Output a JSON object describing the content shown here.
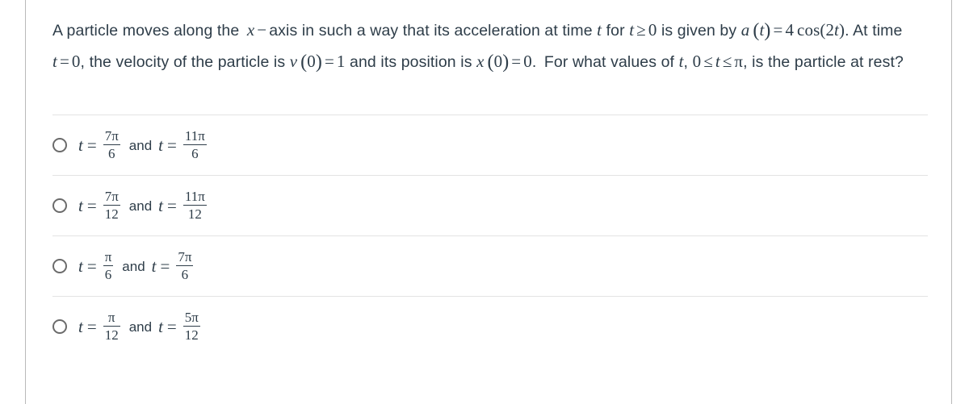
{
  "question": {
    "line1_part1": "A particle moves along the",
    "var_x": "x",
    "dash": "−",
    "line1_part2": "axis in such a way that its acceleration at time",
    "var_t_1": "t",
    "line1_part3": "for",
    "var_t_2": "t",
    "ge": "≥",
    "zero_1": "0",
    "line1_part4": "is",
    "line2_part1": "given by",
    "accel_a": "a",
    "accel_open": "(",
    "accel_t": "t",
    "accel_close": ")",
    "eq_1": "=",
    "coef_4": "4",
    "cos_text": "cos",
    "cos_open": "(",
    "cos_2": "2",
    "cos_t": "t",
    "cos_close": ")",
    "period_1": ".",
    "line2_part2": "At time",
    "var_t_3": "t",
    "eq_2": "=",
    "zero_2": "0",
    "comma_1": ",",
    "line2_part3": "the velocity of the particle is",
    "vel_v": "v",
    "vel_open": "(",
    "vel_zero": "0",
    "vel_close": ")",
    "eq_3": "=",
    "one": "1",
    "line2_part4": "and its",
    "line3_part1": "position is",
    "pos_x": "x",
    "pos_open": "(",
    "pos_zero": "0",
    "pos_close": ")",
    "eq_4": "=",
    "zero_3": "0",
    "period_2": ".",
    "line3_part2": "For what values of",
    "var_t_4": "t",
    "comma_2": ",",
    "zero_4": "0",
    "le_1": "≤",
    "var_t_5": "t",
    "le_2": "≤",
    "pi_sym": "π",
    "comma_3": ",",
    "line3_part3": "is the particle at rest?"
  },
  "options": [
    {
      "id": "option-a",
      "lhs_var": "t",
      "lhs_eq": "=",
      "frac1_num": "7π",
      "frac1_den": "6",
      "connector": "and",
      "rhs_var": "t",
      "rhs_eq": "=",
      "frac2_num": "11π",
      "frac2_den": "6",
      "selected": false
    },
    {
      "id": "option-b",
      "lhs_var": "t",
      "lhs_eq": "=",
      "frac1_num": "7π",
      "frac1_den": "12",
      "connector": "and",
      "rhs_var": "t",
      "rhs_eq": "=",
      "frac2_num": "11π",
      "frac2_den": "12",
      "selected": false
    },
    {
      "id": "option-c",
      "lhs_var": "t",
      "lhs_eq": "=",
      "frac1_num": "π",
      "frac1_den": "6",
      "connector": "and",
      "rhs_var": "t",
      "rhs_eq": "=",
      "frac2_num": "7π",
      "frac2_den": "6",
      "selected": false
    },
    {
      "id": "option-d",
      "lhs_var": "t",
      "lhs_eq": "=",
      "frac1_num": "π",
      "frac1_den": "12",
      "connector": "and",
      "rhs_var": "t",
      "rhs_eq": "=",
      "frac2_num": "5π",
      "frac2_den": "12",
      "selected": false
    }
  ],
  "colors": {
    "text": "#2e3d49",
    "divider": "#e3e3e3",
    "rule": "#b9b9b9",
    "radio_border": "#6b6b6b",
    "background": "#ffffff"
  }
}
